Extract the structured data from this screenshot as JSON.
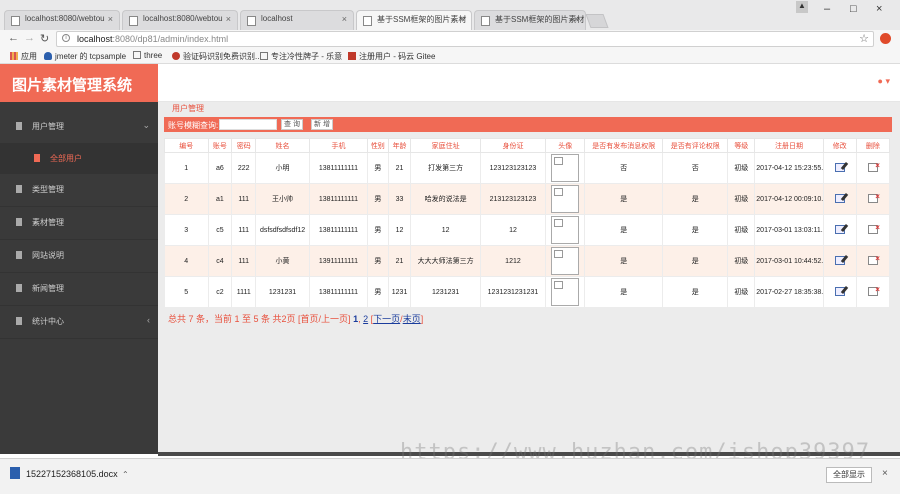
{
  "browser": {
    "tabs": [
      {
        "title": "localhost:8080/webtou",
        "active": false
      },
      {
        "title": "localhost:8080/webtou",
        "active": false
      },
      {
        "title": "localhost",
        "active": false
      },
      {
        "title": "基于SSM框架的图片素材",
        "active": true
      },
      {
        "title": "基于SSM框架的图片素材",
        "active": false
      }
    ],
    "url_host": "localhost",
    "url_path": ":8080/dp81/admin/index.html",
    "bookmarks": [
      "应用",
      "jmeter 的 tcpsample",
      "three",
      "验证码识别免费识别...",
      "专注冷性牌子 - 乐意",
      "注册用户 - 码云 Gitee"
    ]
  },
  "app": {
    "title": "图片素材管理系统",
    "user_icon": "user-icon",
    "sidebar": [
      {
        "label": "用户管理",
        "expanded": true
      },
      {
        "label": "类型管理"
      },
      {
        "label": "素材管理"
      },
      {
        "label": "网站说明"
      },
      {
        "label": "新闻管理"
      },
      {
        "label": "统计中心"
      }
    ],
    "sidebar_sub": "全部用户",
    "breadcrumb": "用户管理",
    "search": {
      "label": "账号模糊查询:",
      "placeholder": "",
      "query_button": "查 询",
      "add_button": "新 增"
    },
    "table": {
      "headers": [
        "编号",
        "账号",
        "密码",
        "姓名",
        "手机",
        "性别",
        "年龄",
        "家庭住址",
        "身份证",
        "头像",
        "是否有发布消息权限",
        "是否有评论权限",
        "等级",
        "注册日期",
        "修改",
        "删除"
      ],
      "rows": [
        [
          "1",
          "a6",
          "222",
          "小明",
          "13811111111",
          "男",
          "21",
          "打发第三方",
          "123123123123",
          "",
          "否",
          "否",
          "初级",
          "2017-04-12 15:23:55.0"
        ],
        [
          "2",
          "a1",
          "111",
          "王小帅",
          "13811111111",
          "男",
          "33",
          "哈发的说法是",
          "213123123123",
          "",
          "是",
          "是",
          "初级",
          "2017-04-12 00:09:10.0"
        ],
        [
          "3",
          "c5",
          "111",
          "dsfsdfsdfsdf12",
          "13811111111",
          "男",
          "12",
          "12",
          "12",
          "",
          "是",
          "是",
          "初级",
          "2017-03-01 13:03:11.0"
        ],
        [
          "4",
          "c4",
          "111",
          "小黄",
          "13911111111",
          "男",
          "21",
          "大大大师法第三方",
          "1212",
          "",
          "是",
          "是",
          "初级",
          "2017-03-01 10:44:52.0"
        ],
        [
          "5",
          "c2",
          "1111",
          "1231231",
          "13811111111",
          "男",
          "1231",
          "1231231",
          "1231231231231",
          "",
          "是",
          "是",
          "初级",
          "2017-02-27 18:35:38.0"
        ]
      ]
    },
    "pager": {
      "summary": "总共 7 条，当前 1 至 5 条 共2页",
      "first_prev": "[首页/上一页]",
      "page1": "1",
      "page2": "2",
      "next_last_open": "[",
      "next": "下一页",
      "slash": "/",
      "last": "末页",
      "close": "]"
    }
  },
  "watermark": "https://www.huzhan.com/ishop39397",
  "download": {
    "file": "15227152368105.docx",
    "show_all": "全部显示"
  },
  "colors": {
    "accent": "#f06a55",
    "sidebar": "#3a3a3a",
    "row_alt": "#fdf0e8"
  }
}
